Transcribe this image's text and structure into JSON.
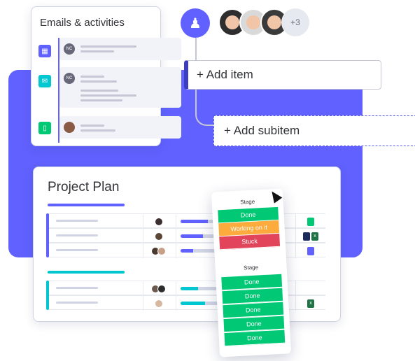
{
  "colors": {
    "brand": "#6161ff",
    "done": "#00c875",
    "working": "#fdab3d",
    "stuck": "#e2445c",
    "teal": "#00c7d0",
    "indigo": "#5559df"
  },
  "emails": {
    "title": "Emails & activities",
    "activities": [
      {
        "icon": "calendar-icon",
        "color": "#6161ff",
        "avatar": "NC"
      },
      {
        "icon": "mail-icon",
        "color": "#00c7d0",
        "avatar": "NC"
      },
      {
        "icon": "phone-icon",
        "color": "#00c875",
        "avatar": ""
      }
    ]
  },
  "people": {
    "invite_icon": "add-user-icon",
    "more_count": "+3"
  },
  "board": {
    "add_item": "+ Add item",
    "add_subitem": "+ Add subitem"
  },
  "project": {
    "title": "Project Plan",
    "groups": [
      {
        "color": "#6161ff",
        "rows": [
          {
            "progress": 0.55,
            "files": [
              "doc"
            ]
          },
          {
            "progress": 0.45,
            "files": [
              "doc",
              "xls"
            ]
          },
          {
            "progress": 0.25,
            "files": [
              "doc"
            ]
          }
        ]
      },
      {
        "color": "#00c7d0",
        "rows": [
          {
            "progress": 0.35,
            "files": []
          },
          {
            "progress": 0.5,
            "files": [
              "xls"
            ]
          }
        ]
      }
    ]
  },
  "stage_panel": {
    "header_top": "Stage",
    "top_statuses": [
      {
        "label": "Done",
        "color": "#00c875"
      },
      {
        "label": "Working on it",
        "color": "#fdab3d"
      },
      {
        "label": "Stuck",
        "color": "#e2445c"
      }
    ],
    "header_bottom": "Stage",
    "bottom_statuses": [
      {
        "label": "Done",
        "color": "#00c875"
      },
      {
        "label": "Done",
        "color": "#00c875"
      },
      {
        "label": "Done",
        "color": "#00c875"
      },
      {
        "label": "Done",
        "color": "#00c875"
      },
      {
        "label": "Done",
        "color": "#00c875"
      }
    ]
  }
}
